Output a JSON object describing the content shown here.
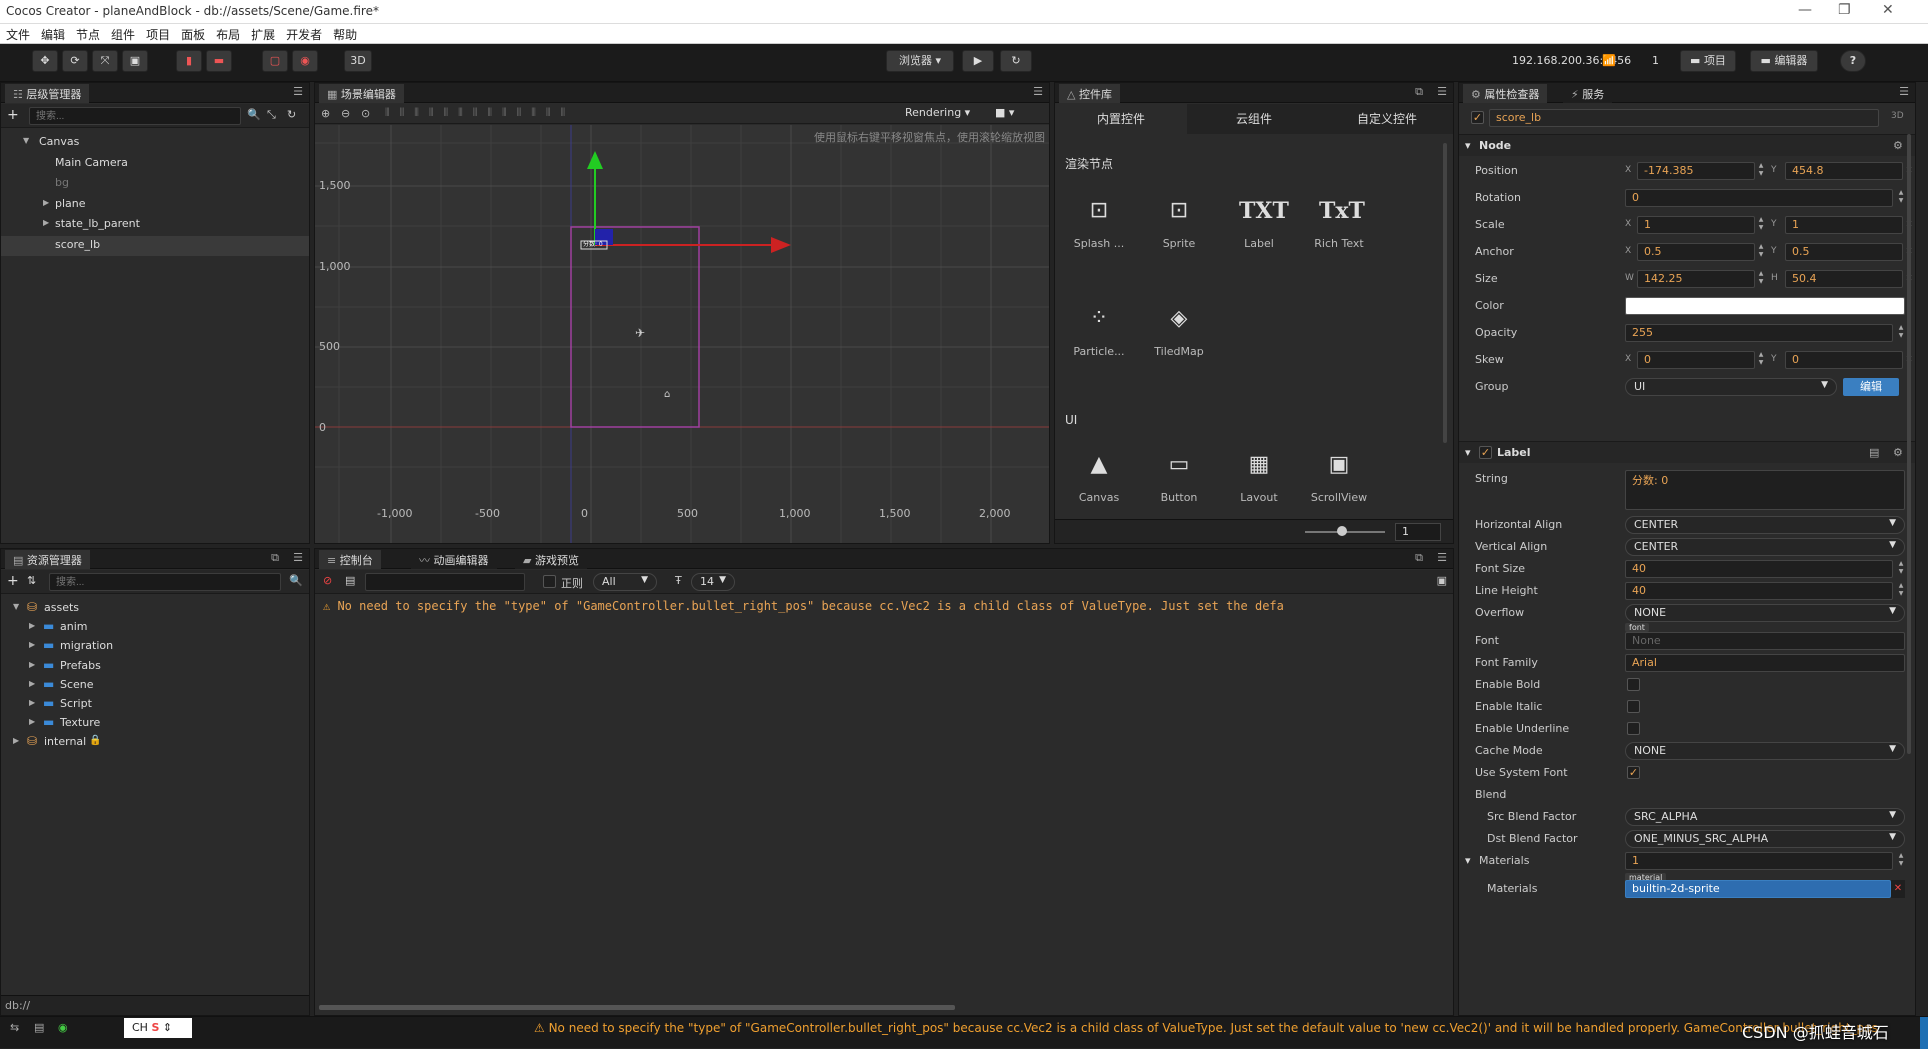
{
  "window": {
    "title": "Cocos Creator - planeAndBlock - db://assets/Scene/Game.fire*"
  },
  "menu": [
    "文件",
    "编辑",
    "节点",
    "组件",
    "项目",
    "面板",
    "布局",
    "扩展",
    "开发者",
    "帮助"
  ],
  "toolbar": {
    "btn3d": "3D",
    "browser": "浏览器 ▾",
    "ip": "192.168.200.36:7456",
    "conn_count": "1",
    "project": "项目",
    "editor": "编辑器",
    "help": "?"
  },
  "hierarchy": {
    "tab": "层级管理器",
    "search_placeholder": "搜索...",
    "nodes": [
      {
        "label": "Canvas",
        "indent": 0,
        "arrow": "▼"
      },
      {
        "label": "Main Camera",
        "indent": 1,
        "arrow": ""
      },
      {
        "label": "bg",
        "indent": 1,
        "arrow": ""
      },
      {
        "label": "plane",
        "indent": 1,
        "arrow": "▶"
      },
      {
        "label": "state_lb_parent",
        "indent": 1,
        "arrow": "▶"
      },
      {
        "label": "score_lb",
        "indent": 1,
        "arrow": ""
      }
    ]
  },
  "scene": {
    "tab": "场景编辑器",
    "rendering": "Rendering",
    "hint": "使用鼠标右键平移视窗焦点，使用滚轮缩放视图",
    "y_labels": [
      "1,500",
      "1,000",
      "500",
      "0"
    ],
    "x_labels": [
      "-1,000",
      "-500",
      "0",
      "500",
      "1,000",
      "1,500",
      "2,000"
    ],
    "node_label": "分数: 0"
  },
  "library": {
    "tab": "控件库",
    "tabs": [
      "内置控件",
      "云组件",
      "自定义控件"
    ],
    "section_render": "渲染节点",
    "render_items": [
      "Splash ...",
      "Sprite",
      "Label",
      "Rich Text",
      "Particle...",
      "TiledMap"
    ],
    "section_ui": "UI",
    "ui_items": [
      "Canvas",
      "Button",
      "Layout",
      "ScrollView"
    ],
    "zoom_value": "1"
  },
  "inspector": {
    "tab": "属性检查器",
    "tab2": "服务",
    "node_name": "score_lb",
    "badge3d": "3D",
    "node_section": "Node",
    "label_section": "Label",
    "props": {
      "position": {
        "label": "Position",
        "x": "-174.385",
        "y": "454.8"
      },
      "rotation": {
        "label": "Rotation",
        "value": "0"
      },
      "scale": {
        "label": "Scale",
        "x": "1",
        "y": "1"
      },
      "anchor": {
        "label": "Anchor",
        "x": "0.5",
        "y": "0.5"
      },
      "size": {
        "label": "Size",
        "w": "142.25",
        "h": "50.4"
      },
      "color": {
        "label": "Color",
        "value": "#ffffff"
      },
      "opacity": {
        "label": "Opacity",
        "value": "255"
      },
      "skew": {
        "label": "Skew",
        "x": "0",
        "y": "0"
      },
      "group": {
        "label": "Group",
        "value": "UI",
        "edit": "编辑"
      }
    },
    "label_props": {
      "string": {
        "label": "String",
        "value": "分数: 0"
      },
      "h_align": {
        "label": "Horizontal Align",
        "value": "CENTER"
      },
      "v_align": {
        "label": "Vertical Align",
        "value": "CENTER"
      },
      "font_size": {
        "label": "Font Size",
        "value": "40"
      },
      "line_height": {
        "label": "Line Height",
        "value": "40"
      },
      "overflow": {
        "label": "Overflow",
        "value": "NONE"
      },
      "font": {
        "label": "Font",
        "tag": "font",
        "value": "None"
      },
      "font_family": {
        "label": "Font Family",
        "value": "Arial"
      },
      "enable_bold": {
        "label": "Enable Bold"
      },
      "enable_italic": {
        "label": "Enable Italic"
      },
      "enable_underline": {
        "label": "Enable Underline"
      },
      "cache_mode": {
        "label": "Cache Mode",
        "value": "NONE"
      },
      "use_system_font": {
        "label": "Use System Font"
      },
      "blend": {
        "label": "Blend"
      },
      "src_blend": {
        "label": "Src Blend Factor",
        "value": "SRC_ALPHA"
      },
      "dst_blend": {
        "label": "Dst Blend Factor",
        "value": "ONE_MINUS_SRC_ALPHA"
      },
      "materials_count": {
        "label": "Materials",
        "value": "1"
      },
      "materials": {
        "label": "Materials",
        "tag": "material",
        "value": "builtin-2d-sprite"
      }
    }
  },
  "assets": {
    "tab": "资源管理器",
    "search_placeholder": "搜索...",
    "items": [
      {
        "label": "assets",
        "indent": 0,
        "arrow": "▼",
        "kind": "db"
      },
      {
        "label": "anim",
        "indent": 1,
        "arrow": "▶",
        "kind": "folder"
      },
      {
        "label": "migration",
        "indent": 1,
        "arrow": "▶",
        "kind": "folder"
      },
      {
        "label": "Prefabs",
        "indent": 1,
        "arrow": "▶",
        "kind": "folder"
      },
      {
        "label": "Scene",
        "indent": 1,
        "arrow": "▶",
        "kind": "folder"
      },
      {
        "label": "Script",
        "indent": 1,
        "arrow": "▶",
        "kind": "folder"
      },
      {
        "label": "Texture",
        "indent": 1,
        "arrow": "▶",
        "kind": "folder"
      },
      {
        "label": "internal",
        "indent": 0,
        "arrow": "▶",
        "kind": "db-locked"
      }
    ],
    "footer": "db://"
  },
  "console": {
    "tabs": [
      "控制台",
      "动画编辑器",
      "游戏预览"
    ],
    "regex": "正则",
    "level": "All",
    "font_size": "14",
    "message": "No need to specify the \"type\" of \"GameController.bullet_right_pos\" because cc.Vec2 is a child class of ValueType. Just set the defa"
  },
  "statusbar": {
    "ime": "CH",
    "message": "No need to specify the \"type\" of \"GameController.bullet_right_pos\" because cc.Vec2 is a child class of ValueType. Just set the default value to 'new cc.Vec2()' and it will be handled properly. GameController bullet_right_pos",
    "watermark": "CSDN @抓蛙音城石"
  }
}
